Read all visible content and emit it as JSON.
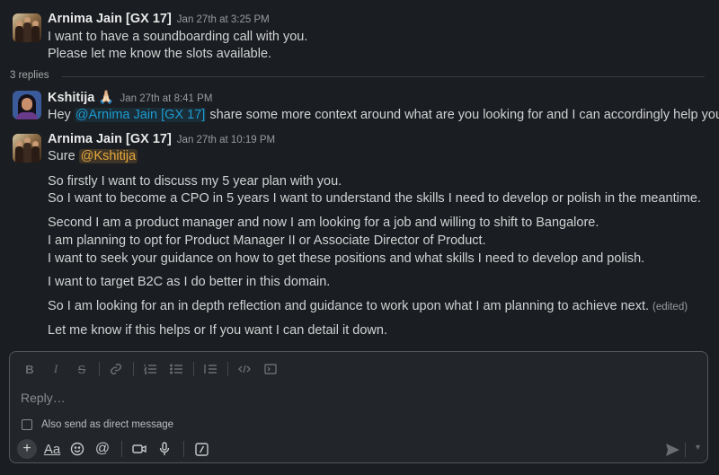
{
  "messages": [
    {
      "author": "Arnima Jain [GX 17]",
      "time": "Jan 27th at 3:25 PM",
      "lines": [
        "I want to have a soundboarding call with you.",
        "Please let me know the slots available."
      ]
    },
    {
      "author": "Kshitija 🙏🏻",
      "time": "Jan 27th at 8:41 PM",
      "line_prefix": "Hey ",
      "mention": "@Arnima Jain [GX 17]",
      "line_suffix": " share some more context around what are you looking for and I can accordingly help you out"
    },
    {
      "author": "Arnima Jain [GX 17]",
      "time": "Jan 27th at 10:19 PM",
      "first_prefix": "Sure ",
      "first_mention": "@Kshitija",
      "lines": [
        "So firstly I want to discuss my 5 year plan with you.",
        "So I want to become a CPO in 5 years I want to understand the skills I need to develop or polish in the meantime.",
        "Second I am a product manager and now I am looking for a job and willing to shift to Bangalore.",
        "I am planning to opt for Product Manager II or Associate Director of Product.",
        "I want to seek your guidance on how to get these positions and what skills I need to develop and polish.",
        "I want to target B2C as I do better in this domain.",
        "So I am looking for an in depth reflection and guidance to work upon what I am planning to achieve next.",
        "Let me know if this helps or If you want I can detail it down."
      ],
      "edited_label": "(edited)"
    }
  ],
  "thread": {
    "replies_label": "3 replies"
  },
  "composer": {
    "placeholder": "Reply…",
    "dm_label": "Also send as direct message",
    "format_icons": [
      "bold-icon",
      "italic-icon",
      "strikethrough-icon",
      "link-icon",
      "ordered-list-icon",
      "bulleted-list-icon",
      "blockquote-icon",
      "code-icon",
      "code-block-icon"
    ],
    "bottom_icons": [
      "plus-icon",
      "formatting-icon",
      "emoji-icon",
      "mention-icon",
      "video-icon",
      "microphone-icon",
      "slash-command-icon"
    ],
    "send_icon": "send-icon"
  },
  "colors": {
    "background": "#1a1d21",
    "mention": "#1d9bd1",
    "self_mention": "#e8a93d"
  }
}
